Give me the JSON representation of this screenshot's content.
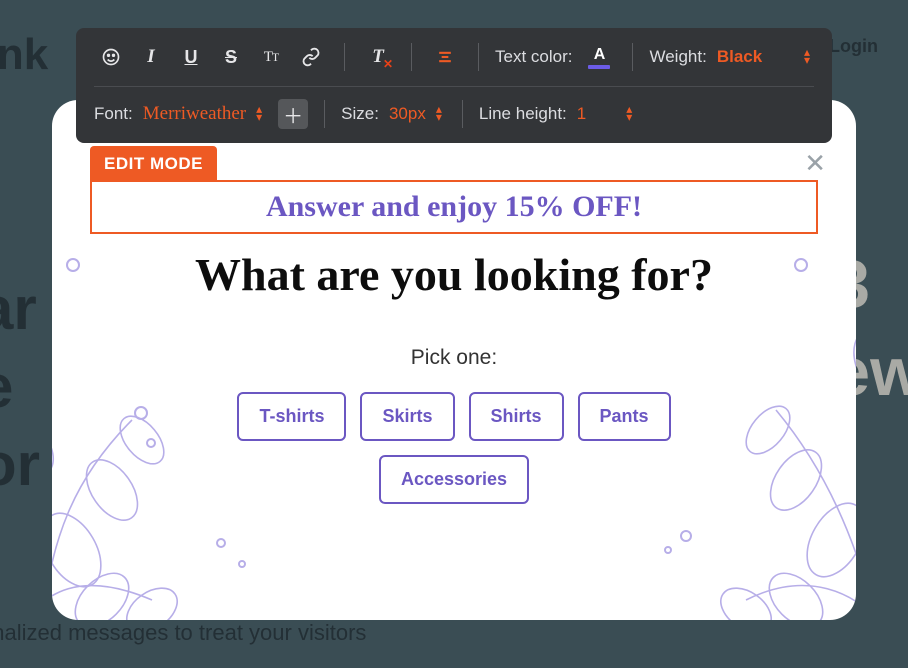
{
  "background": {
    "brand_fragment": "onk",
    "login": "Login",
    "headline_lines": [
      "ar",
      "e",
      "or"
    ],
    "subtext": "onalized messages to treat your visitors",
    "promo_lines": [
      "3",
      "ew"
    ]
  },
  "toolbar": {
    "text_color_label": "Text color:",
    "weight_label": "Weight:",
    "weight_value": "Black",
    "font_label": "Font:",
    "font_value": "Merriweather",
    "size_label": "Size:",
    "size_value": "30px",
    "line_height_label": "Line height:",
    "line_height_value": "1"
  },
  "modal": {
    "edit_badge": "EDIT MODE",
    "editable_heading": "Answer and enjoy 15% OFF!",
    "main_heading": "What are you looking for?",
    "sub_heading": "Pick one:",
    "options": [
      "T-shirts",
      "Skirts",
      "Shirts",
      "Pants",
      "Accessories"
    ]
  }
}
